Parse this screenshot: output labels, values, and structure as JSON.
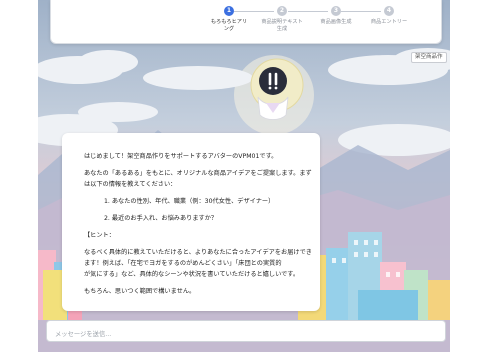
{
  "stepper": {
    "steps": [
      {
        "number": "1",
        "label": "もろもろヒアリ\nング",
        "active": true
      },
      {
        "number": "2",
        "label": "商品説明テキスト\n生成",
        "active": false
      },
      {
        "number": "3",
        "label": "商品画像生成",
        "active": false
      },
      {
        "number": "4",
        "label": "商品エントリー",
        "active": false
      }
    ],
    "colors": {
      "active": "#3b6fe0",
      "inactive": "#c5cad3"
    }
  },
  "avatar": {
    "name_tag": "架空商品作"
  },
  "chat": {
    "lines": [
      "はじめまして！架空商品作りをサポートするアバターのVPM01です。",
      "あなたの「あるある」をもとに、オリジナルな商品アイデアをご提案します。まず",
      "は以下の情報を教えてください：",
      "1. あなたの性別、年代、職業（例：30代女性、デザイナー）",
      "2. 最近のお手入れ、お悩みありますか？",
      "【ヒント：",
      "なるべく具体的に教えていただけると、よりあなたに合ったアイデアをお届けでき",
      "ます！例えば、「在宅でヨガをするのがめんどくさい」「床団との実質的",
      "が気にする」など、具体的なシーンや状況を書いていただけると嬉しいです。",
      "もちろん、思いつく範囲で構いません。"
    ]
  },
  "input": {
    "placeholder": "メッセージを送信..."
  },
  "colors": {
    "sky": "#b9c8db",
    "card": "#ffffff",
    "accent": "#3b6fe0"
  }
}
